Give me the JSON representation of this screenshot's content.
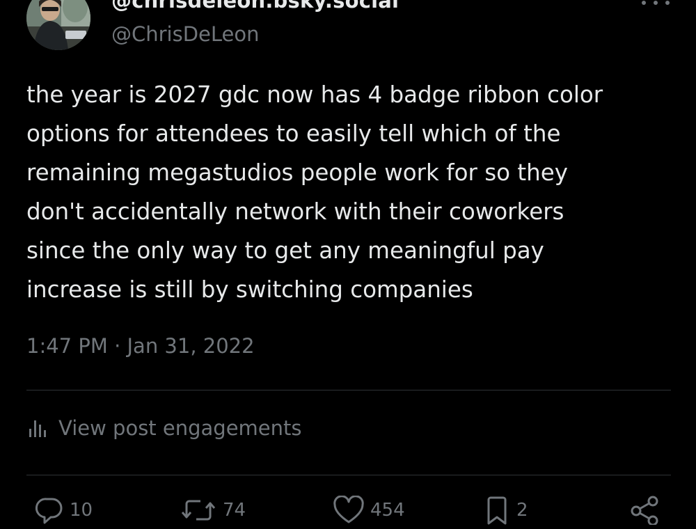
{
  "author": {
    "display_name": "@chrisdeleon.bsky.social",
    "handle": "@ChrisDeLeon"
  },
  "post": {
    "text": "the year is 2027 gdc now has 4 badge ribbon color\noptions for attendees to easily tell which of the\nremaining megastudios people work for so they\ndon't accidentally network with their coworkers\nsince the only way to get any meaningful pay\nincrease is still by switching companies",
    "timestamp": "1:47 PM · Jan 31, 2022"
  },
  "engagements": {
    "label": "View post engagements",
    "icon": "bar-chart-icon"
  },
  "actions": {
    "replies": "10",
    "reposts": "74",
    "likes": "454",
    "bookmarks": "2"
  },
  "icons": {
    "reply": "reply-icon",
    "repost": "repost-icon",
    "like": "heart-icon",
    "bookmark": "bookmark-icon",
    "share": "share-icon",
    "more": "more-icon"
  },
  "colors": {
    "background": "#000000",
    "text": "#e7e9ea",
    "secondary": "#71767b",
    "divider": "#2f3336"
  }
}
